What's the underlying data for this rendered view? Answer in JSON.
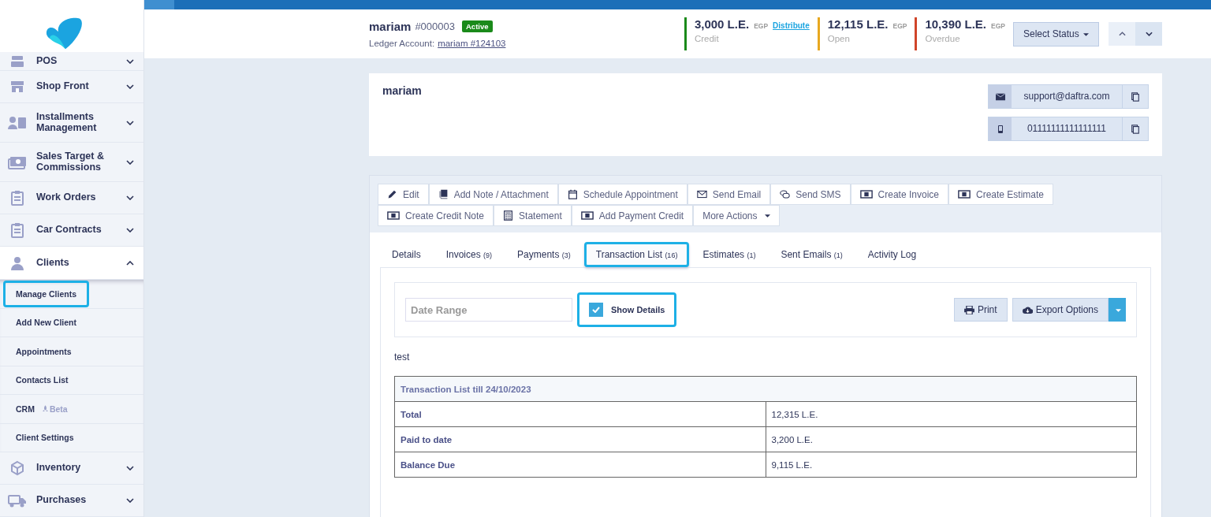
{
  "sidebar": {
    "items": [
      {
        "label": "POS",
        "expanded": false
      },
      {
        "label": "Shop Front",
        "expanded": false
      },
      {
        "label": "Installments Management",
        "expanded": false
      },
      {
        "label": "Sales Target & Commissions",
        "expanded": false
      },
      {
        "label": "Work Orders",
        "expanded": false
      },
      {
        "label": "Car Contracts",
        "expanded": false
      },
      {
        "label": "Clients",
        "expanded": true,
        "children": [
          {
            "label": "Manage Clients",
            "selected": true
          },
          {
            "label": "Add New Client",
            "selected": false
          },
          {
            "label": "Appointments",
            "selected": false
          },
          {
            "label": "Contacts List",
            "selected": false
          },
          {
            "label": "CRM",
            "badge": "Beta",
            "selected": false
          },
          {
            "label": "Client Settings",
            "selected": false
          }
        ]
      },
      {
        "label": "Inventory",
        "expanded": false
      },
      {
        "label": "Purchases",
        "expanded": false
      }
    ]
  },
  "header": {
    "name": "mariam",
    "number": "#000003",
    "status": "Active",
    "ledger_label": "Ledger Account:",
    "ledger_link": "mariam #124103",
    "stats": [
      {
        "amount": "3,000 L.E.",
        "currency": "EGP",
        "label": "Credit",
        "color": "#1a8a1a",
        "link": "Distribute"
      },
      {
        "amount": "12,115 L.E.",
        "currency": "EGP",
        "label": "Open",
        "color": "#e8a820"
      },
      {
        "amount": "10,390 L.E.",
        "currency": "EGP",
        "label": "Overdue",
        "color": "#d0452a"
      }
    ],
    "status_button": "Select Status"
  },
  "contact_card": {
    "name": "mariam",
    "email": "support@daftra.com",
    "phone": "01111111111111111"
  },
  "actions": [
    "Edit",
    "Add Note / Attachment",
    "Schedule Appointment",
    "Send Email",
    "Send SMS",
    "Create Invoice",
    "Create Estimate",
    "Create Credit Note",
    "Statement",
    "Add Payment Credit",
    "More Actions"
  ],
  "tabs": [
    {
      "label": "Details",
      "selected": false
    },
    {
      "label": "Invoices",
      "count": "(9)",
      "selected": false
    },
    {
      "label": "Payments",
      "count": "(3)",
      "selected": false
    },
    {
      "label": "Transaction List",
      "count": "(16)",
      "selected": true
    },
    {
      "label": "Estimates",
      "count": "(1)",
      "selected": false
    },
    {
      "label": "Sent Emails",
      "count": "(1)",
      "selected": false
    },
    {
      "label": "Activity Log",
      "selected": false
    }
  ],
  "filters": {
    "date_range": {
      "placeholder": "Date Range"
    },
    "show_details": {
      "label": "Show Details",
      "checked": true,
      "highlighted": true
    },
    "print": "Print",
    "export": "Export Options"
  },
  "note": "test",
  "summary": {
    "title": "Transaction List till 24/10/2023",
    "rows": [
      {
        "label": "Total",
        "value": "12,315 L.E."
      },
      {
        "label": "Paid to date",
        "value": "3,200 L.E."
      },
      {
        "label": "Balance Due",
        "value": "9,115 L.E."
      }
    ]
  }
}
